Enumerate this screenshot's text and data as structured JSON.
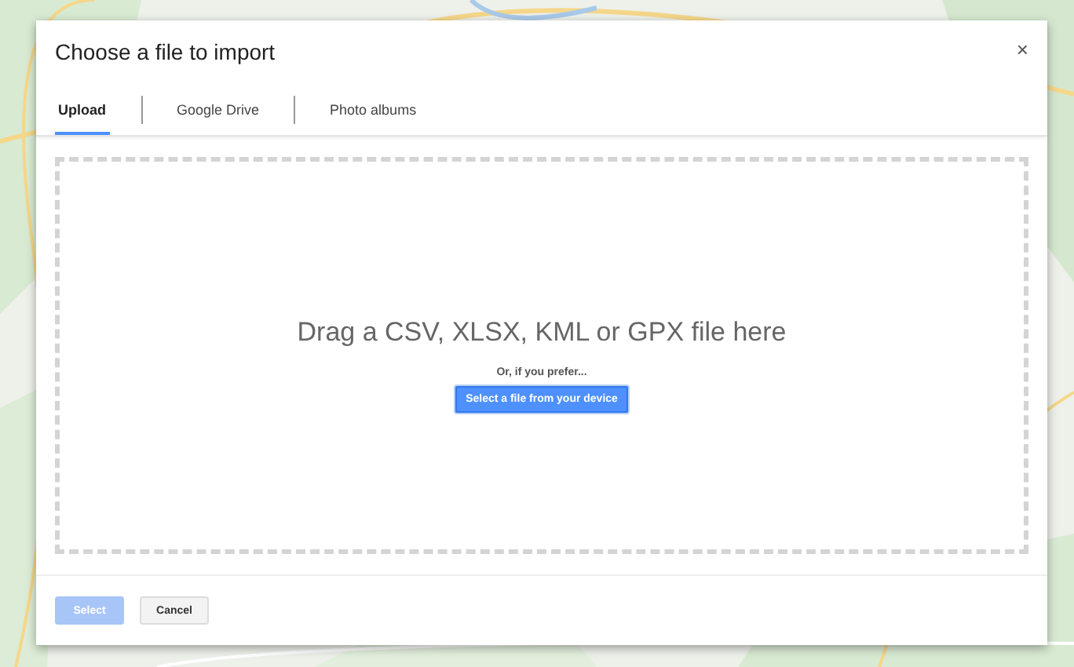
{
  "dialog": {
    "title": "Choose a file to import",
    "close": "×"
  },
  "tabs": [
    {
      "label": "Upload",
      "selected": true
    },
    {
      "label": "Google Drive",
      "selected": false
    },
    {
      "label": "Photo albums",
      "selected": false
    }
  ],
  "dropzone": {
    "heading": "Drag a CSV, XLSX, KML or GPX file here",
    "hint": "Or, if you prefer...",
    "button": "Select a file from your device"
  },
  "footer": {
    "buttons": [
      {
        "label": "Select",
        "kind": "primary",
        "disabled": true
      },
      {
        "label": "Cancel",
        "kind": "secondary",
        "disabled": false
      }
    ]
  }
}
